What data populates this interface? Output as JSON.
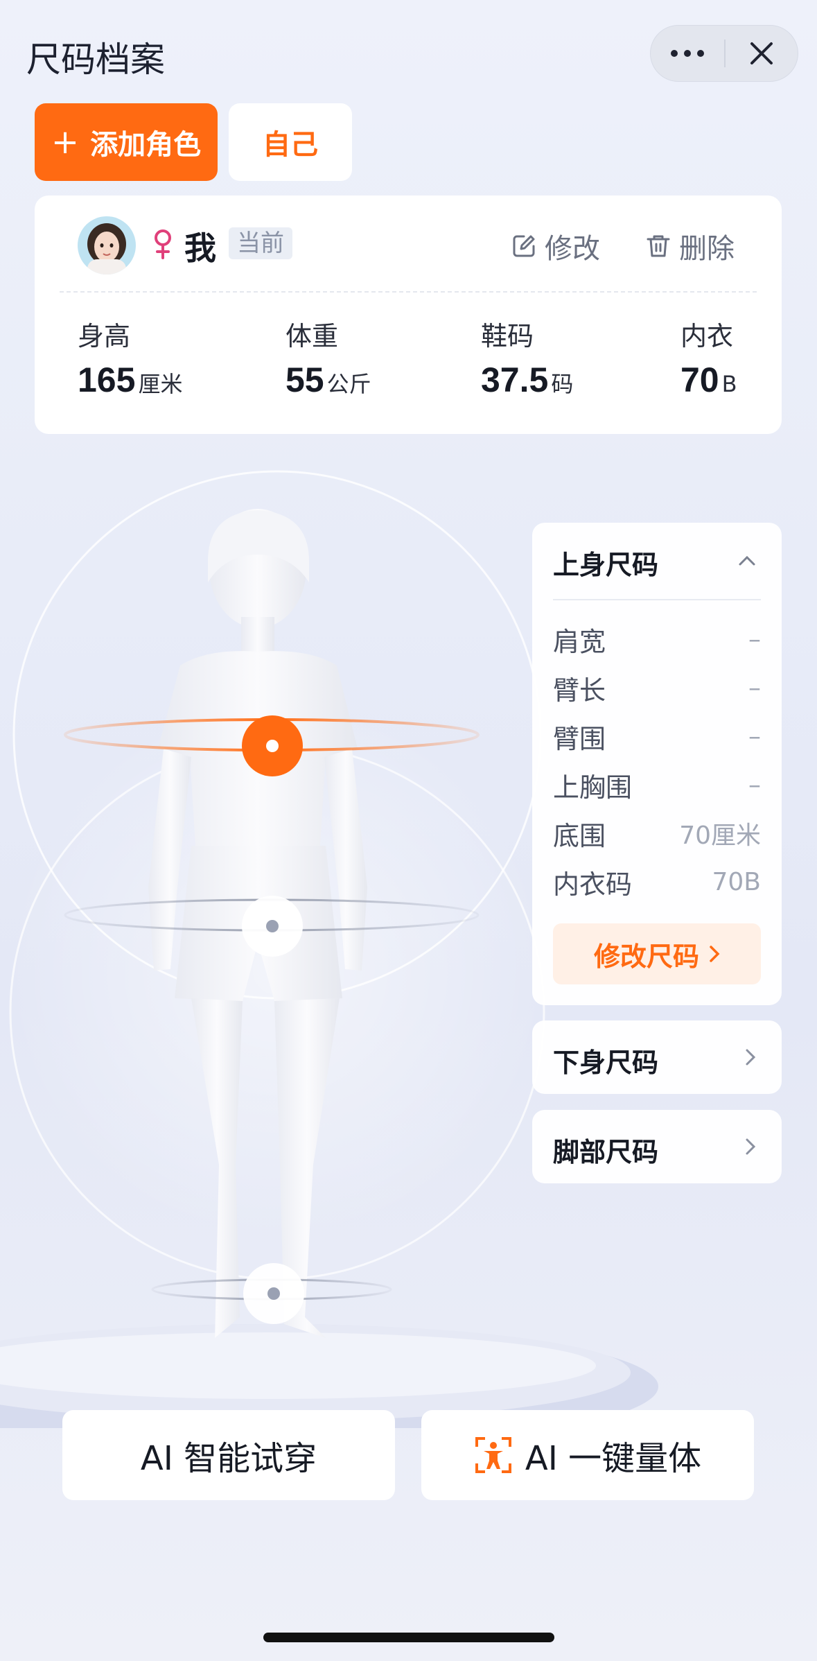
{
  "header": {
    "title": "尺码档案"
  },
  "roles": {
    "add_label": "添加角色",
    "self_label": "自己"
  },
  "profile": {
    "name": "我",
    "badge": "当前",
    "edit_label": "修改",
    "delete_label": "删除",
    "stats": [
      {
        "label": "身高",
        "value": "165",
        "unit": "厘米"
      },
      {
        "label": "体重",
        "value": "55",
        "unit": "公斤"
      },
      {
        "label": "鞋码",
        "value": "37.5",
        "unit": "码"
      },
      {
        "label": "内衣",
        "value": "70",
        "unit": "B"
      }
    ]
  },
  "upper_panel": {
    "title": "上身尺码",
    "rows": [
      {
        "label": "肩宽",
        "value": "–"
      },
      {
        "label": "臂长",
        "value": "–"
      },
      {
        "label": "臂围",
        "value": "–"
      },
      {
        "label": "上胸围",
        "value": "–"
      },
      {
        "label": "底围",
        "value": "70厘米"
      },
      {
        "label": "内衣码",
        "value": "70B"
      }
    ],
    "modify_label": "修改尺码"
  },
  "lower_panel": {
    "title": "下身尺码"
  },
  "feet_panel": {
    "title": "脚部尺码"
  },
  "bottom": {
    "tryon_label": "AI 智能试穿",
    "measure_label": "AI 一键量体"
  },
  "colors": {
    "accent": "#ff6a12",
    "gender": "#e0407a"
  }
}
